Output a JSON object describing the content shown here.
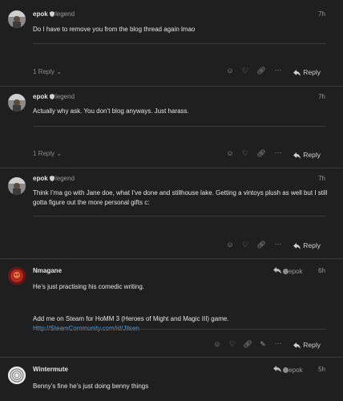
{
  "posts": [
    {
      "username": "epok",
      "group": "legend",
      "time": "7h",
      "text": "Do I have to remove you from the blog thread again lmao",
      "replies": "1 Reply",
      "reply_label": "Reply"
    },
    {
      "username": "epok",
      "group": "legend",
      "time": "7h",
      "text": "Actually why ask. You don’t blog anyways. Just harass.",
      "replies": "1 Reply",
      "reply_label": "Reply"
    },
    {
      "username": "epok",
      "group": "legend",
      "time": "7h",
      "text": "Think I’ma go with Jane doe, what I’ve done and stillhouse lake. Getting a vintoys plush as well but I still gotta figure out the more personal gifts c:",
      "reply_label": "Reply"
    },
    {
      "username": "Nmagane",
      "reply_to": "epok",
      "time": "6h",
      "text": "He’s just practising his comedic writing.",
      "signature_text": "Add me on Steam for HoMM 3 (Heroes of Might and Magic III) game.",
      "signature_link": "Http://SteamCommunity.com/id/Jilsen",
      "reply_label": "Reply"
    },
    {
      "username": "Wintermute",
      "reply_to": "epok",
      "time": "5h",
      "text": "Benny’s fine he’s just doing benny things"
    }
  ],
  "colors": {
    "background": "#1f1f1f",
    "link": "#4ca3e8",
    "muted": "#9a9a9a"
  },
  "icons": [
    "smile-icon",
    "heart-icon",
    "link-icon",
    "ellipsis-icon",
    "reply-icon",
    "edit-icon",
    "chevron-down-icon",
    "reply-to-arrow-icon",
    "shield-flair-icon"
  ]
}
